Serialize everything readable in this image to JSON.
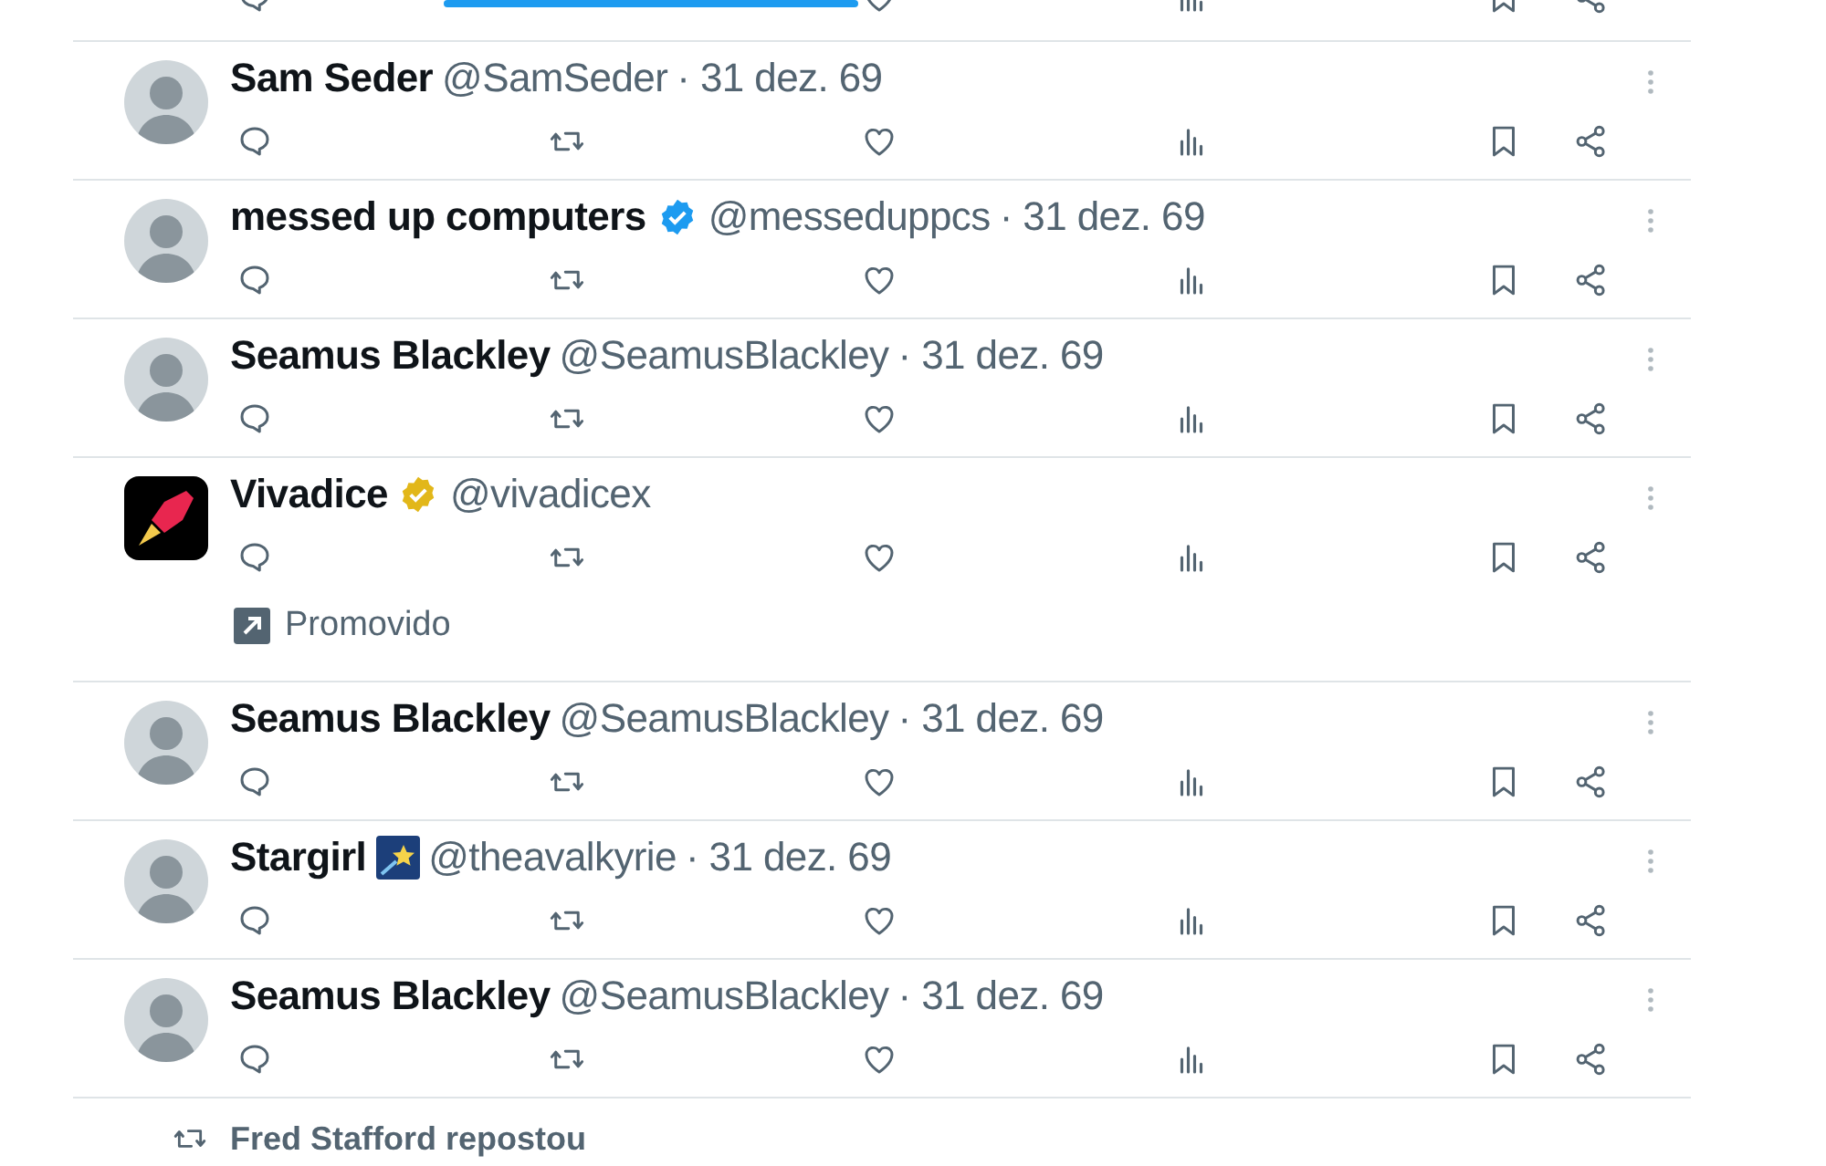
{
  "tweets": [
    {
      "kind": "tweet",
      "name": "Sam Seder",
      "handle": "@SamSeder",
      "date": "· 31 dez. 69"
    },
    {
      "kind": "tweet",
      "name": "messed up computers",
      "badge": {
        "kind": "verified",
        "color": "#1d9bf0"
      },
      "handle": "@messeduppcs",
      "date": "· 31 dez. 69"
    },
    {
      "kind": "tweet",
      "name": "Seamus Blackley",
      "handle": "@SeamusBlackley",
      "date": "· 31 dez. 69"
    },
    {
      "kind": "ad",
      "name": "Vivadice",
      "badge": {
        "kind": "verified",
        "color": "#e2b719"
      },
      "handle": "@vivadicex",
      "promoted_label": "Promovido"
    },
    {
      "kind": "tweet",
      "name": "Seamus Blackley",
      "handle": "@SeamusBlackley",
      "date": "· 31 dez. 69"
    },
    {
      "kind": "tweet",
      "name": "Stargirl",
      "badge": {
        "kind": "image"
      },
      "handle": "@theavalkyrie",
      "date": "· 31 dez. 69"
    },
    {
      "kind": "tweet",
      "name": "Seamus Blackley",
      "handle": "@SeamusBlackley",
      "date": "· 31 dez. 69"
    },
    {
      "kind": "repost",
      "text": "Fred Stafford repostou"
    }
  ]
}
